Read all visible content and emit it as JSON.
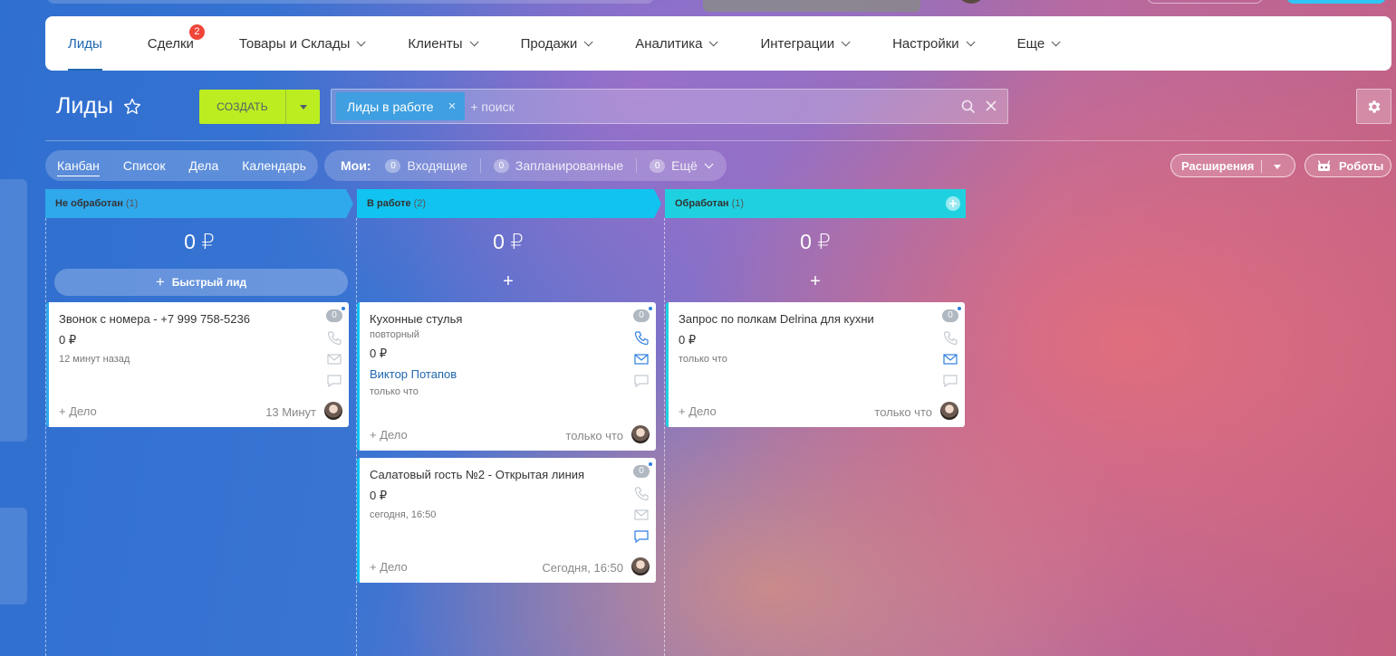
{
  "nav": {
    "items": [
      {
        "label": "Лиды",
        "dropdown": false,
        "active": true
      },
      {
        "label": "Сделки",
        "dropdown": false,
        "badge": "2"
      },
      {
        "label": "Товары и Склады",
        "dropdown": true
      },
      {
        "label": "Клиенты",
        "dropdown": true
      },
      {
        "label": "Продажи",
        "dropdown": true
      },
      {
        "label": "Аналитика",
        "dropdown": true
      },
      {
        "label": "Интеграции",
        "dropdown": true
      },
      {
        "label": "Настройки",
        "dropdown": true
      },
      {
        "label": "Еще",
        "dropdown": true
      }
    ]
  },
  "page": {
    "title": "Лиды"
  },
  "create_button": {
    "label": "СОЗДАТЬ"
  },
  "filter": {
    "chip": "Лиды в работе",
    "placeholder": "+ поиск"
  },
  "views": {
    "items": [
      "Канбан",
      "Список",
      "Дела",
      "Календарь"
    ],
    "active": "Канбан"
  },
  "counters": {
    "label": "Мои:",
    "items": [
      {
        "count": "0",
        "label": "Входящие"
      },
      {
        "count": "0",
        "label": "Запланированные"
      },
      {
        "count": "0",
        "label": "Ещё"
      }
    ]
  },
  "extensions_button": {
    "label": "Расширения"
  },
  "robots_button": {
    "label": "Роботы"
  },
  "columns": [
    {
      "title": "Не обработан",
      "count": "(1)",
      "sum": "0 ₽",
      "color": "#2fa8ec",
      "quick_lead_label": "Быстрый лид"
    },
    {
      "title": "В работе",
      "count": "(2)",
      "sum": "0 ₽",
      "color": "#11c3f0",
      "plus_label": "+"
    },
    {
      "title": "Обработан",
      "count": "(1)",
      "sum": "0 ₽",
      "color": "#1fd1e0",
      "plus_label": "+"
    }
  ],
  "cards": [
    {
      "title": "Звонок с номера - +7 999 758-5236",
      "sum": "0 ₽",
      "date": "12 минут назад",
      "deal_label": "+ Дело",
      "time": "13 Минут",
      "badge": "0",
      "accent": "#2fa8ec"
    },
    {
      "title": "Кухонные стулья",
      "subtitle": "повторный",
      "sum": "0 ₽",
      "contact": "Виктор Потапов",
      "date": "только что",
      "deal_label": "+ Дело",
      "time": "только что",
      "badge": "0",
      "accent": "#11c3f0"
    },
    {
      "title": "Салатовый гость №2 - Открытая линия",
      "sum": "0 ₽",
      "date": "сегодня, 16:50",
      "deal_label": "+ Дело",
      "time": "Сегодня, 16:50",
      "badge": "0",
      "accent": "#11c3f0"
    },
    {
      "title": "Запрос по полкам Delrina для кухни",
      "sum": "0 ₽",
      "date": "только что",
      "deal_label": "+ Дело",
      "time": "только что",
      "badge": "0",
      "accent": "#1fd1e0"
    }
  ],
  "icons": {
    "star": "star-icon",
    "settings": "gear-icon",
    "search": "search-icon",
    "close": "close-icon",
    "phone": "phone-icon",
    "mail": "mail-icon",
    "chat": "chat-icon",
    "robot": "robot-icon"
  }
}
